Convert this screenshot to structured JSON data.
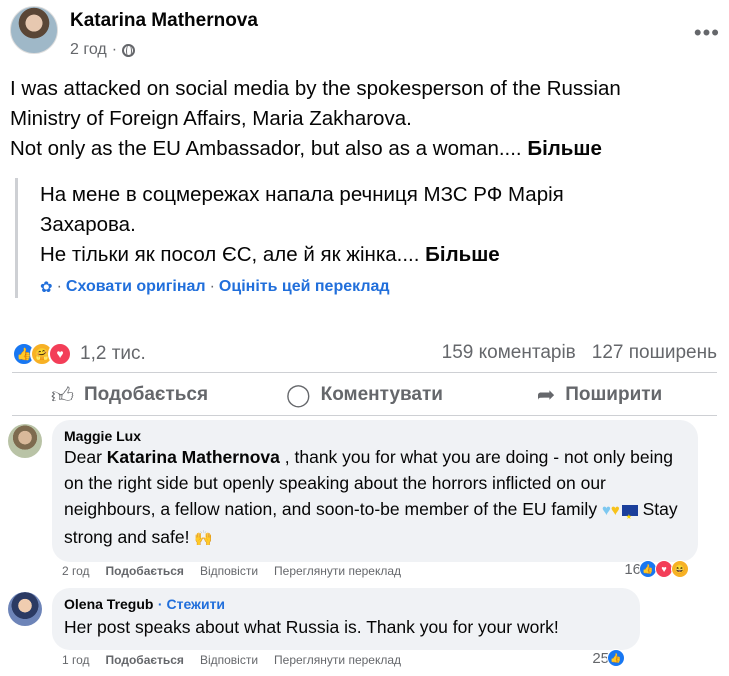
{
  "post": {
    "author": "Katarina Mathernova",
    "time": "2 год",
    "text_lines": [
      "I was attacked on social media by the spokesperson of the Russian",
      "Ministry of Foreign Affairs, Maria Zakharova.",
      "Not only as the EU Ambassador, but also as a woman...."
    ],
    "see_more": "Більше",
    "translation": {
      "lines": [
        "На мене в соцмережах напала речниця МЗС РФ Марія",
        "Захарова.",
        "Не тільки як посол ЄС, але й як жінка...."
      ],
      "see_more": "Більше",
      "hide_original": "Сховати оригінал",
      "rate_translation": "Оцініть цей переклад",
      "separator": "·"
    }
  },
  "stats": {
    "reaction_count": "1,2 тис.",
    "comments": "159 коментарів",
    "shares": "127 поширень"
  },
  "actions": {
    "like": "Подобається",
    "comment": "Коментувати",
    "share": "Поширити"
  },
  "comments": [
    {
      "author": "Maggie Lux",
      "text_before_mention": "Dear ",
      "mention": "Katarina Mathernova",
      "text_after_mention": " , thank you for what you are doing - not only being on the right side but openly speaking about the horrors inflicted on our neighbours, a fellow nation, and soon-to-be member of the EU family",
      "text_end": " Stay strong and safe!",
      "time": "2 год",
      "like_label": "Подобається",
      "reply_label": "Відповісти",
      "translate_label": "Переглянути переклад",
      "reaction_count": "16"
    },
    {
      "author": "Olena Tregub",
      "follow": "· Стежити",
      "text": "Her post speaks about what Russia is. Thank you for your work!",
      "time": "1 год",
      "like_label": "Подобається",
      "reply_label": "Відповісти",
      "translate_label": "Переглянути переклад",
      "reaction_count": "25"
    }
  ]
}
